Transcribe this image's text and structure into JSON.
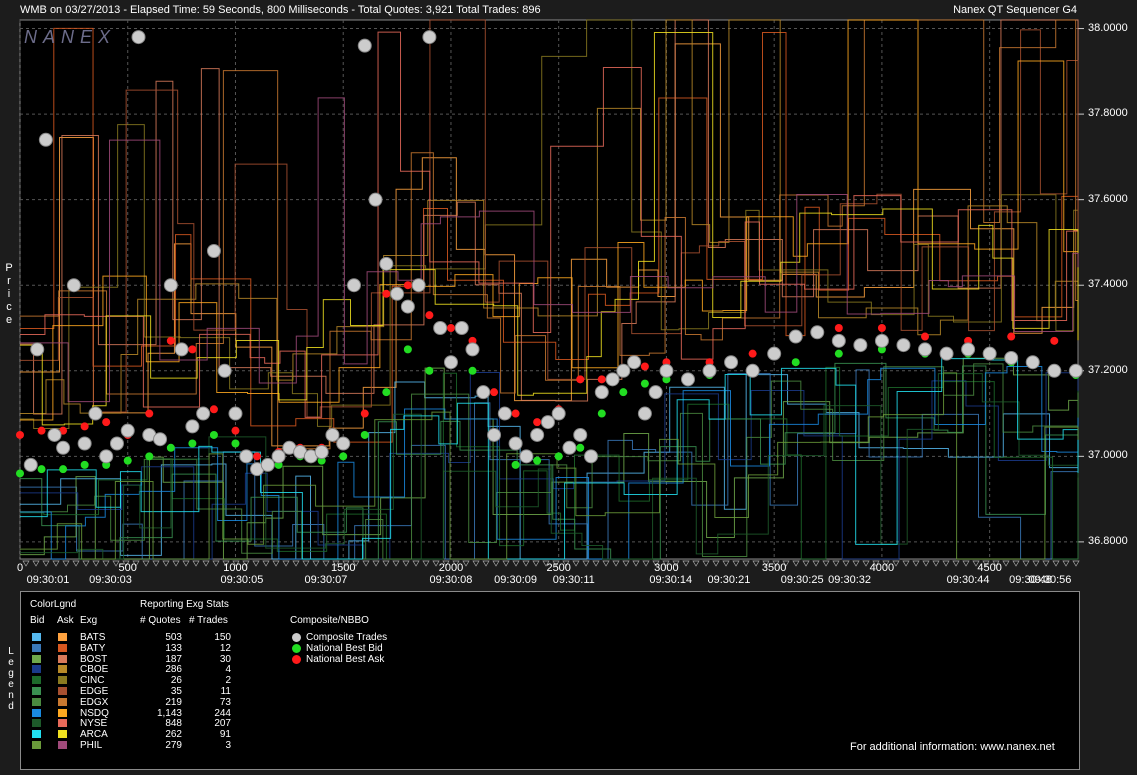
{
  "header": {
    "title": "WMB on 03/27/2013  -  Elapsed Time: 59 Seconds, 800 Milliseconds  -  Total Quotes: 3,921  Total Trades: 896",
    "app": "Nanex QT Sequencer G4",
    "watermark": "NANEX"
  },
  "chart_data": {
    "type": "scatter",
    "ylabel": "Price",
    "ylim": [
      36.76,
      38.02
    ],
    "xlim": [
      0,
      4910
    ],
    "yticks": [
      "38.0000",
      "37.8000",
      "37.6000",
      "37.4000",
      "37.2000",
      "37.0000",
      "36.8000"
    ],
    "ytick_values": [
      38.0,
      37.8,
      37.6,
      37.4,
      37.2,
      37.0,
      36.8
    ],
    "xticks": [
      "0",
      "500",
      "1000",
      "1500",
      "2000",
      "2500",
      "3000",
      "3500",
      "4000",
      "4500"
    ],
    "xtick_values": [
      0,
      500,
      1000,
      1500,
      2000,
      2500,
      3000,
      3500,
      4000,
      4500
    ],
    "time_labels": [
      "09:30:01",
      "09:30:03",
      "09:30:05",
      "09:30:07",
      "09:30:08",
      "09:30:09",
      "09:30:11",
      "09:30:14",
      "09:30:21",
      "09:30:25",
      "09:30:32",
      "09:30:44",
      "09:30:48",
      "09:30:56"
    ],
    "time_label_positions": [
      130,
      420,
      1030,
      1420,
      2000,
      2300,
      2570,
      3020,
      3290,
      3630,
      3850,
      4400,
      4690,
      5000
    ],
    "grid": true,
    "series": [
      {
        "name": "Composite Trades",
        "color": "#cccccc",
        "x": [
          50,
          80,
          120,
          160,
          200,
          250,
          300,
          350,
          400,
          450,
          500,
          550,
          600,
          650,
          700,
          750,
          800,
          850,
          900,
          950,
          1000,
          1050,
          1100,
          1150,
          1200,
          1250,
          1300,
          1350,
          1400,
          1450,
          1500,
          1550,
          1600,
          1650,
          1700,
          1750,
          1800,
          1850,
          1900,
          1950,
          2000,
          2050,
          2100,
          2150,
          2200,
          2250,
          2300,
          2350,
          2400,
          2450,
          2500,
          2550,
          2600,
          2650,
          2700,
          2750,
          2800,
          2850,
          2900,
          2950,
          3000,
          3100,
          3200,
          3300,
          3400,
          3500,
          3600,
          3700,
          3800,
          3900,
          4000,
          4100,
          4200,
          4300,
          4400,
          4500,
          4600,
          4700,
          4800,
          4900
        ],
        "y": [
          36.98,
          37.25,
          37.74,
          37.05,
          37.02,
          37.4,
          37.03,
          37.1,
          37.0,
          37.03,
          37.06,
          37.98,
          37.05,
          37.04,
          37.4,
          37.25,
          37.07,
          37.1,
          37.48,
          37.2,
          37.1,
          37.0,
          36.97,
          36.98,
          37.0,
          37.02,
          37.01,
          37.0,
          37.01,
          37.05,
          37.03,
          37.4,
          37.96,
          37.6,
          37.45,
          37.38,
          37.35,
          37.4,
          37.98,
          37.3,
          37.22,
          37.3,
          37.25,
          37.15,
          37.05,
          37.1,
          37.03,
          37.0,
          37.05,
          37.08,
          37.1,
          37.02,
          37.05,
          37.0,
          37.15,
          37.18,
          37.2,
          37.22,
          37.1,
          37.15,
          37.2,
          37.18,
          37.2,
          37.22,
          37.2,
          37.24,
          37.28,
          37.29,
          37.27,
          37.26,
          37.27,
          37.26,
          37.25,
          37.24,
          37.25,
          37.24,
          37.23,
          37.22,
          37.2,
          37.2
        ]
      },
      {
        "name": "National Best Bid",
        "color": "#22dd22",
        "x": [
          0,
          100,
          200,
          300,
          400,
          500,
          600,
          700,
          800,
          900,
          1000,
          1100,
          1200,
          1300,
          1400,
          1500,
          1600,
          1700,
          1800,
          1900,
          2000,
          2100,
          2200,
          2300,
          2400,
          2500,
          2600,
          2700,
          2800,
          2900,
          3000,
          3200,
          3400,
          3600,
          3800,
          4000,
          4200,
          4400,
          4600,
          4800,
          4900
        ],
        "y": [
          36.96,
          36.97,
          36.97,
          36.98,
          36.98,
          36.99,
          37.0,
          37.02,
          37.03,
          37.05,
          37.03,
          36.97,
          36.98,
          37.0,
          36.99,
          37.0,
          37.05,
          37.15,
          37.25,
          37.2,
          37.22,
          37.2,
          37.05,
          36.98,
          36.99,
          37.0,
          37.02,
          37.1,
          37.15,
          37.17,
          37.18,
          37.19,
          37.2,
          37.22,
          37.24,
          37.25,
          37.24,
          37.24,
          37.22,
          37.2,
          37.19
        ]
      },
      {
        "name": "National Best Ask",
        "color": "#ff1a1a",
        "x": [
          0,
          100,
          200,
          300,
          400,
          500,
          600,
          700,
          800,
          900,
          1000,
          1100,
          1200,
          1300,
          1400,
          1500,
          1600,
          1700,
          1800,
          1900,
          2000,
          2100,
          2200,
          2300,
          2400,
          2500,
          2600,
          2700,
          2800,
          2900,
          3000,
          3200,
          3400,
          3600,
          3800,
          4000,
          4200,
          4400,
          4600,
          4800
        ],
        "y": [
          37.05,
          37.06,
          37.06,
          37.07,
          37.08,
          37.05,
          37.1,
          37.27,
          37.25,
          37.11,
          37.06,
          37.0,
          37.01,
          37.02,
          37.02,
          37.03,
          37.1,
          37.38,
          37.4,
          37.33,
          37.3,
          37.27,
          37.15,
          37.1,
          37.08,
          37.11,
          37.18,
          37.18,
          37.2,
          37.21,
          37.22,
          37.22,
          37.24,
          37.28,
          37.3,
          37.3,
          37.28,
          37.27,
          37.28,
          37.27
        ]
      }
    ]
  },
  "legend": {
    "title_colorlgnd": "ColorLgnd",
    "col_bid": "Bid",
    "col_ask": "Ask",
    "col_exg": "Exg",
    "stats_title": "Reporting Exg Stats",
    "col_quotes": "# Quotes",
    "col_trades": "# Trades",
    "vert_label": "Legend",
    "rows": [
      {
        "exg": "BATS",
        "quotes": "503",
        "trades": "150",
        "bid_color": "#55b8ee",
        "ask_color": "#ffa340"
      },
      {
        "exg": "BATY",
        "quotes": "133",
        "trades": "12",
        "bid_color": "#3a78b8",
        "ask_color": "#d85820"
      },
      {
        "exg": "BOST",
        "quotes": "187",
        "trades": "30",
        "bid_color": "#6fa84a",
        "ask_color": "#d87a5a"
      },
      {
        "exg": "CBOE",
        "quotes": "286",
        "trades": "4",
        "bid_color": "#1a3a8a",
        "ask_color": "#b88a28"
      },
      {
        "exg": "CINC",
        "quotes": "26",
        "trades": "2",
        "bid_color": "#1d6a2a",
        "ask_color": "#8a7a20"
      },
      {
        "exg": "EDGE",
        "quotes": "35",
        "trades": "11",
        "bid_color": "#3a9050",
        "ask_color": "#a85030"
      },
      {
        "exg": "EDGX",
        "quotes": "219",
        "trades": "73",
        "bid_color": "#4a8a40",
        "ask_color": "#c87830"
      },
      {
        "exg": "NSDQ",
        "quotes": "1,143",
        "trades": "244",
        "bid_color": "#1a8ae0",
        "ask_color": "#ffa820"
      },
      {
        "exg": "NYSE",
        "quotes": "848",
        "trades": "207",
        "bid_color": "#1d5a2a",
        "ask_color": "#e86a5a"
      },
      {
        "exg": "ARCA",
        "quotes": "262",
        "trades": "91",
        "bid_color": "#22e0f0",
        "ask_color": "#f0e020"
      },
      {
        "exg": "PHIL",
        "quotes": "279",
        "trades": "3",
        "bid_color": "#6a9a3a",
        "ask_color": "#a04a7a"
      }
    ],
    "composite_title": "Composite/NBBO",
    "composite_items": [
      {
        "label": "Composite Trades",
        "color": "#cccccc"
      },
      {
        "label": "National Best Bid",
        "color": "#22dd22"
      },
      {
        "label": "National Best Ask",
        "color": "#ff1a1a"
      }
    ],
    "footer": "For additional information: www.nanex.net"
  }
}
